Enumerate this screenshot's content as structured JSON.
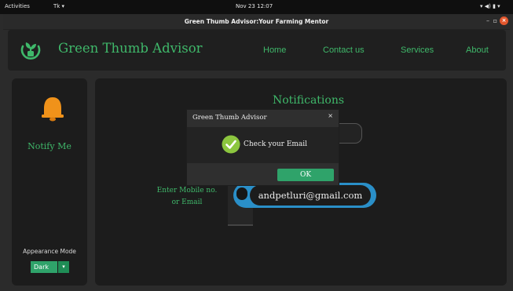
{
  "system_bar": {
    "activities": "Activities",
    "app": "Tk ▾",
    "datetime": "Nov 23  12:07",
    "tray": "▾ ◀) ▮ ▾"
  },
  "window": {
    "title": "Green Thumb Advisor:Your Farming Mentor",
    "minimize": "–",
    "maximize": "▫",
    "close": "×"
  },
  "header": {
    "brand": "Green Thumb Advisor",
    "nav": [
      "Home",
      "Contact us",
      "Services",
      "About"
    ]
  },
  "sidebar": {
    "notify_label": "Notify Me",
    "appearance_label": "Appearance Mode",
    "mode_value": "Dark",
    "mode_arrow": "▾"
  },
  "main": {
    "title": "Notifications",
    "enter_label_line1": "Enter Mobile no.",
    "enter_label_line2": "or Email",
    "email_value": "andpetluri@gmail.com"
  },
  "dialog": {
    "title": "Green Thumb Advisor",
    "close": "×",
    "message": "Check your Email",
    "ok_label": "OK"
  },
  "colors": {
    "accent_green": "#3fb86a",
    "button_green": "#2fa36a",
    "email_border": "#2a8fc8",
    "bell_orange": "#f0921a"
  }
}
